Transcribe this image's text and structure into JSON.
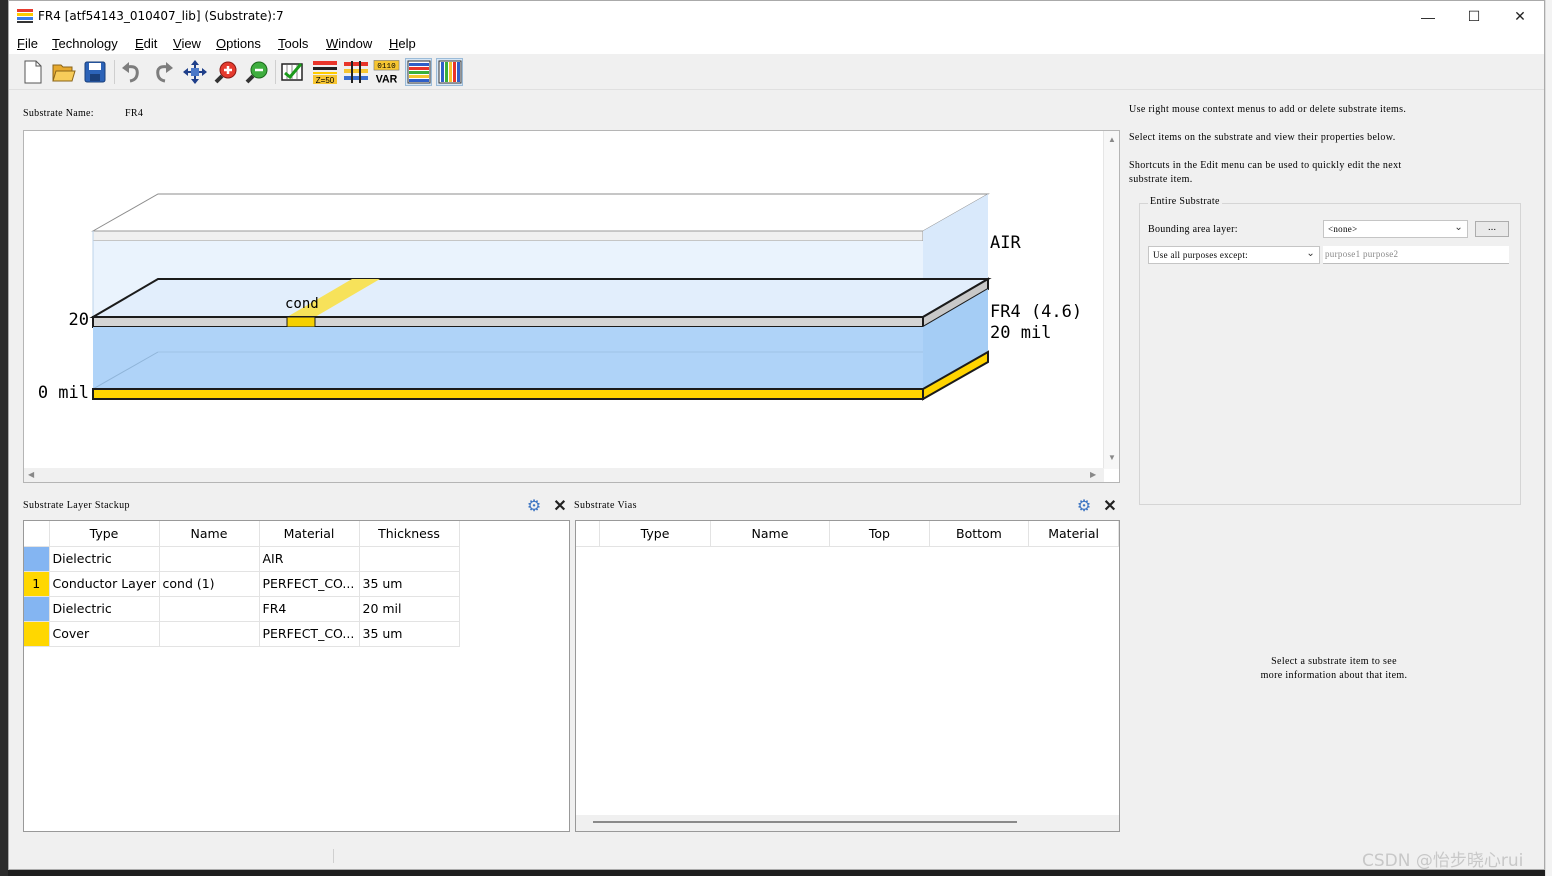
{
  "window": {
    "title": "FR4 [atf54143_010407_lib] (Substrate):7",
    "controls": {
      "minimize": "—",
      "maximize": "☐",
      "close": "✕"
    }
  },
  "menu": [
    {
      "label": "File"
    },
    {
      "label": "Technology"
    },
    {
      "label": "Edit"
    },
    {
      "label": "View"
    },
    {
      "label": "Options"
    },
    {
      "label": "Tools"
    },
    {
      "label": "Window"
    },
    {
      "label": "Help"
    }
  ],
  "toolbar": {
    "buttons": [
      "new-file-icon",
      "open-folder-icon",
      "save-icon",
      "undo-icon",
      "redo-icon",
      "pan-icon",
      "zoom-in-icon",
      "zoom-out-icon",
      "check-icon",
      "impedance-z50-icon",
      "layer-stack-icon",
      "variable-var-icon",
      "horizontal-layers-icon",
      "vertical-layers-icon"
    ],
    "z50_label": "Z=50",
    "var_bits": "0110",
    "var_label": "VAR"
  },
  "substrate": {
    "name_label": "Substrate Name:",
    "name_value": "FR4",
    "diagram": {
      "labels": {
        "air": "AIR",
        "fr4": "FR4 (4.6)",
        "fr4_thickness": "20 mil",
        "cond": "cond",
        "top_axis": "20",
        "bottom_axis": "0 mil"
      },
      "colors": {
        "dielectric": "#a9d1f7",
        "conductor": "#ffd800",
        "air": "#e8f2fc"
      }
    }
  },
  "stackup": {
    "title": "Substrate Layer Stackup",
    "columns": [
      "Type",
      "Name",
      "Material",
      "Thickness"
    ],
    "rows": [
      {
        "swatch": "#84b5f2",
        "index": "",
        "type": "Dielectric",
        "name": "",
        "material": "AIR",
        "thickness": ""
      },
      {
        "swatch": "#ffd700",
        "index": "1",
        "type": "Conductor Layer",
        "name": "cond (1)",
        "material": "PERFECT_CO...",
        "thickness": "35 um"
      },
      {
        "swatch": "#84b5f2",
        "index": "",
        "type": "Dielectric",
        "name": "",
        "material": "FR4",
        "thickness": "20 mil"
      },
      {
        "swatch": "#ffd700",
        "index": "",
        "type": "Cover",
        "name": "",
        "material": "PERFECT_CO...",
        "thickness": "35 um"
      }
    ]
  },
  "vias": {
    "title": "Substrate Vias",
    "columns": [
      "Type",
      "Name",
      "Top",
      "Bottom",
      "Material"
    ]
  },
  "properties": {
    "help": [
      "Use right mouse context menus to add or delete substrate items.",
      "Select items on the substrate and view their properties below.",
      "Shortcuts in the Edit menu can be used to quickly edit the next",
      "substrate item."
    ],
    "group_title": "Entire Substrate",
    "bounding_label": "Bounding area layer:",
    "bounding_value": "<none>",
    "browse_label": "...",
    "purposes_select": "Use all purposes except:",
    "purposes_placeholder": "purpose1 purpose2",
    "select_hint_1": "Select a substrate item to see",
    "select_hint_2": "more information about that item."
  },
  "watermark": "CSDN @怡步晓心rui"
}
